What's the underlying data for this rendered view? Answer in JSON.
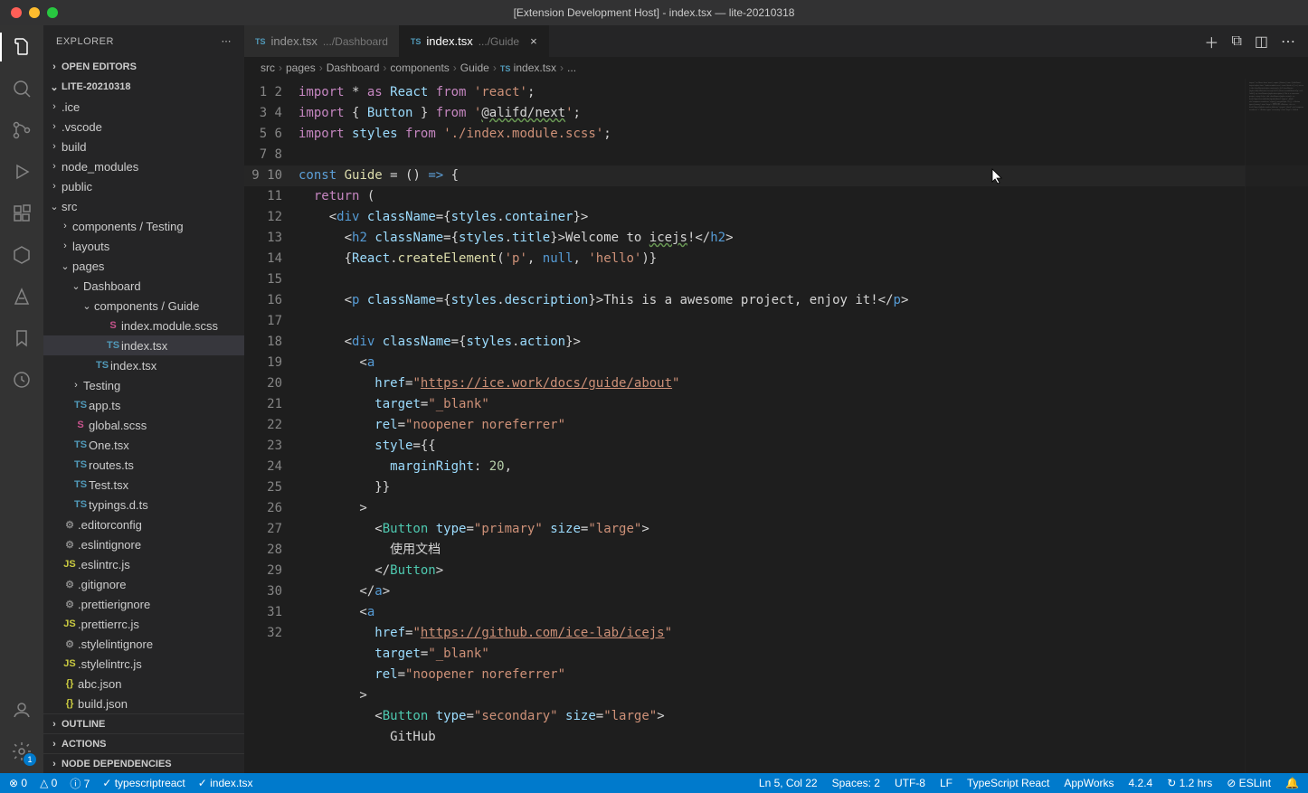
{
  "title": "[Extension Development Host] - index.tsx — lite-20210318",
  "explorer": {
    "title": "EXPLORER",
    "openEditors": "OPEN EDITORS",
    "project": "LITE-20210318",
    "outline": "OUTLINE",
    "actions": "ACTIONS",
    "nodeDeps": "NODE DEPENDENCIES"
  },
  "tree": [
    {
      "d": 1,
      "t": "folder",
      "open": false,
      "n": ".ice"
    },
    {
      "d": 1,
      "t": "folder",
      "open": false,
      "n": ".vscode"
    },
    {
      "d": 1,
      "t": "folder",
      "open": false,
      "n": "build"
    },
    {
      "d": 1,
      "t": "folder",
      "open": false,
      "n": "node_modules"
    },
    {
      "d": 1,
      "t": "folder",
      "open": false,
      "n": "public"
    },
    {
      "d": 1,
      "t": "folder",
      "open": true,
      "n": "src"
    },
    {
      "d": 2,
      "t": "folder",
      "open": false,
      "n": "components / Testing"
    },
    {
      "d": 2,
      "t": "folder",
      "open": false,
      "n": "layouts"
    },
    {
      "d": 2,
      "t": "folder",
      "open": true,
      "n": "pages"
    },
    {
      "d": 3,
      "t": "folder",
      "open": true,
      "n": "Dashboard"
    },
    {
      "d": 4,
      "t": "folder",
      "open": true,
      "n": "components / Guide"
    },
    {
      "d": 5,
      "t": "file",
      "i": "scss",
      "n": "index.module.scss"
    },
    {
      "d": 5,
      "t": "file",
      "i": "ts",
      "n": "index.tsx",
      "sel": true
    },
    {
      "d": 4,
      "t": "file",
      "i": "ts",
      "n": "index.tsx"
    },
    {
      "d": 3,
      "t": "folder",
      "open": false,
      "n": "Testing"
    },
    {
      "d": 2,
      "t": "file",
      "i": "ts",
      "n": "app.ts"
    },
    {
      "d": 2,
      "t": "file",
      "i": "scss",
      "n": "global.scss"
    },
    {
      "d": 2,
      "t": "file",
      "i": "ts",
      "n": "One.tsx"
    },
    {
      "d": 2,
      "t": "file",
      "i": "ts",
      "n": "routes.ts"
    },
    {
      "d": 2,
      "t": "file",
      "i": "ts",
      "n": "Test.tsx"
    },
    {
      "d": 2,
      "t": "file",
      "i": "ts",
      "n": "typings.d.ts"
    },
    {
      "d": 1,
      "t": "file",
      "i": "cfg",
      "n": ".editorconfig"
    },
    {
      "d": 1,
      "t": "file",
      "i": "cfg",
      "n": ".eslintignore"
    },
    {
      "d": 1,
      "t": "file",
      "i": "js",
      "n": ".eslintrc.js"
    },
    {
      "d": 1,
      "t": "file",
      "i": "cfg",
      "n": ".gitignore"
    },
    {
      "d": 1,
      "t": "file",
      "i": "cfg",
      "n": ".prettierignore"
    },
    {
      "d": 1,
      "t": "file",
      "i": "js",
      "n": ".prettierrc.js"
    },
    {
      "d": 1,
      "t": "file",
      "i": "cfg",
      "n": ".stylelintignore"
    },
    {
      "d": 1,
      "t": "file",
      "i": "js",
      "n": ".stylelintrc.js"
    },
    {
      "d": 1,
      "t": "file",
      "i": "json",
      "n": "abc.json"
    },
    {
      "d": 1,
      "t": "file",
      "i": "json",
      "n": "build.json"
    }
  ],
  "tabs": [
    {
      "lang": "TS",
      "name": "index.tsx",
      "hint": ".../Dashboard",
      "active": false
    },
    {
      "lang": "TS",
      "name": "index.tsx",
      "hint": ".../Guide",
      "active": true
    }
  ],
  "breadcrumb": [
    "src",
    "pages",
    "Dashboard",
    "components",
    "Guide",
    "index.tsx",
    "..."
  ],
  "bc_lang": "TS",
  "gutter_start": 1,
  "gutter_end": 32,
  "code_lines": [
    [
      [
        "kw",
        "import"
      ],
      [
        "op",
        " * "
      ],
      [
        "kw",
        "as"
      ],
      [
        "op",
        " "
      ],
      [
        "id",
        "React"
      ],
      [
        "op",
        " "
      ],
      [
        "kw",
        "from"
      ],
      [
        "op",
        " "
      ],
      [
        "st",
        "'react'"
      ],
      [
        "pu",
        ";"
      ]
    ],
    [
      [
        "kw",
        "import"
      ],
      [
        "op",
        " { "
      ],
      [
        "id",
        "Button"
      ],
      [
        "op",
        " } "
      ],
      [
        "kw",
        "from"
      ],
      [
        "op",
        " "
      ],
      [
        "st",
        "'"
      ],
      [
        "ul",
        "@alifd/next"
      ],
      [
        "st",
        "'"
      ],
      [
        "pu",
        ";"
      ]
    ],
    [
      [
        "kw",
        "import"
      ],
      [
        "op",
        " "
      ],
      [
        "id",
        "styles"
      ],
      [
        "op",
        " "
      ],
      [
        "kw",
        "from"
      ],
      [
        "op",
        " "
      ],
      [
        "st",
        "'./index.module.scss'"
      ],
      [
        "pu",
        ";"
      ]
    ],
    [],
    [
      [
        "kw2",
        "const"
      ],
      [
        "op",
        " "
      ],
      [
        "fn",
        "Guide"
      ],
      [
        "op",
        " = () "
      ],
      [
        "kw2",
        "=>"
      ],
      [
        "op",
        " {"
      ]
    ],
    [
      [
        "op",
        "  "
      ],
      [
        "kw",
        "return"
      ],
      [
        "op",
        " ("
      ]
    ],
    [
      [
        "op",
        "    <"
      ],
      [
        "tg",
        "div"
      ],
      [
        "op",
        " "
      ],
      [
        "at",
        "className"
      ],
      [
        "op",
        "={"
      ],
      [
        "id",
        "styles"
      ],
      [
        "op",
        "."
      ],
      [
        "id",
        "container"
      ],
      [
        "op",
        "}>"
      ]
    ],
    [
      [
        "op",
        "      <"
      ],
      [
        "tg",
        "h2"
      ],
      [
        "op",
        " "
      ],
      [
        "at",
        "className"
      ],
      [
        "op",
        "={"
      ],
      [
        "id",
        "styles"
      ],
      [
        "op",
        "."
      ],
      [
        "id",
        "title"
      ],
      [
        "op",
        "}>Welcome to "
      ],
      [
        "ul",
        "icejs"
      ],
      [
        "op",
        "!</"
      ],
      [
        "tg",
        "h2"
      ],
      [
        "op",
        ">"
      ]
    ],
    [
      [
        "op",
        "      {"
      ],
      [
        "id",
        "React"
      ],
      [
        "op",
        "."
      ],
      [
        "fn",
        "createElement"
      ],
      [
        "op",
        "("
      ],
      [
        "st",
        "'p'"
      ],
      [
        "op",
        ", "
      ],
      [
        "kw2",
        "null"
      ],
      [
        "op",
        ", "
      ],
      [
        "st",
        "'hello'"
      ],
      [
        "op",
        ")}"
      ]
    ],
    [],
    [
      [
        "op",
        "      <"
      ],
      [
        "tg",
        "p"
      ],
      [
        "op",
        " "
      ],
      [
        "at",
        "className"
      ],
      [
        "op",
        "={"
      ],
      [
        "id",
        "styles"
      ],
      [
        "op",
        "."
      ],
      [
        "id",
        "description"
      ],
      [
        "op",
        "}>This is a awesome project, enjoy it!</"
      ],
      [
        "tg",
        "p"
      ],
      [
        "op",
        ">"
      ]
    ],
    [],
    [
      [
        "op",
        "      <"
      ],
      [
        "tg",
        "div"
      ],
      [
        "op",
        " "
      ],
      [
        "at",
        "className"
      ],
      [
        "op",
        "={"
      ],
      [
        "id",
        "styles"
      ],
      [
        "op",
        "."
      ],
      [
        "id",
        "action"
      ],
      [
        "op",
        "}>"
      ]
    ],
    [
      [
        "op",
        "        <"
      ],
      [
        "tg",
        "a"
      ]
    ],
    [
      [
        "op",
        "          "
      ],
      [
        "at",
        "href"
      ],
      [
        "op",
        "="
      ],
      [
        "st",
        "\""
      ],
      [
        "lk",
        "https://ice.work/docs/guide/about"
      ],
      [
        "st",
        "\""
      ]
    ],
    [
      [
        "op",
        "          "
      ],
      [
        "at",
        "target"
      ],
      [
        "op",
        "="
      ],
      [
        "st",
        "\"_blank\""
      ]
    ],
    [
      [
        "op",
        "          "
      ],
      [
        "at",
        "rel"
      ],
      [
        "op",
        "="
      ],
      [
        "st",
        "\"noopener noreferrer\""
      ]
    ],
    [
      [
        "op",
        "          "
      ],
      [
        "at",
        "style"
      ],
      [
        "op",
        "={{"
      ]
    ],
    [
      [
        "op",
        "            "
      ],
      [
        "id",
        "marginRight"
      ],
      [
        "op",
        ": "
      ],
      [
        "nu",
        "20"
      ],
      [
        "op",
        ","
      ]
    ],
    [
      [
        "op",
        "          }}"
      ]
    ],
    [
      [
        "op",
        "        >"
      ]
    ],
    [
      [
        "op",
        "          <"
      ],
      [
        "ty",
        "Button"
      ],
      [
        "op",
        " "
      ],
      [
        "at",
        "type"
      ],
      [
        "op",
        "="
      ],
      [
        "st",
        "\"primary\""
      ],
      [
        "op",
        " "
      ],
      [
        "at",
        "size"
      ],
      [
        "op",
        "="
      ],
      [
        "st",
        "\"large\""
      ],
      [
        "op",
        ">"
      ]
    ],
    [
      [
        "op",
        "            使用文档"
      ]
    ],
    [
      [
        "op",
        "          </"
      ],
      [
        "ty",
        "Button"
      ],
      [
        "op",
        ">"
      ]
    ],
    [
      [
        "op",
        "        </"
      ],
      [
        "tg",
        "a"
      ],
      [
        "op",
        ">"
      ]
    ],
    [
      [
        "op",
        "        <"
      ],
      [
        "tg",
        "a"
      ]
    ],
    [
      [
        "op",
        "          "
      ],
      [
        "at",
        "href"
      ],
      [
        "op",
        "="
      ],
      [
        "st",
        "\""
      ],
      [
        "lk",
        "https://github.com/ice-lab/icejs"
      ],
      [
        "st",
        "\""
      ]
    ],
    [
      [
        "op",
        "          "
      ],
      [
        "at",
        "target"
      ],
      [
        "op",
        "="
      ],
      [
        "st",
        "\"_blank\""
      ]
    ],
    [
      [
        "op",
        "          "
      ],
      [
        "at",
        "rel"
      ],
      [
        "op",
        "="
      ],
      [
        "st",
        "\"noopener noreferrer\""
      ]
    ],
    [
      [
        "op",
        "        >"
      ]
    ],
    [
      [
        "op",
        "          <"
      ],
      [
        "ty",
        "Button"
      ],
      [
        "op",
        " "
      ],
      [
        "at",
        "type"
      ],
      [
        "op",
        "="
      ],
      [
        "st",
        "\"secondary\""
      ],
      [
        "op",
        " "
      ],
      [
        "at",
        "size"
      ],
      [
        "op",
        "="
      ],
      [
        "st",
        "\"large\""
      ],
      [
        "op",
        ">"
      ]
    ],
    [
      [
        "op",
        "            GitHub"
      ]
    ]
  ],
  "status": {
    "errors": "⊗ 0",
    "warnings": "△ 0",
    "info": "ⓘ 7",
    "lang": "✓ typescriptreact",
    "file": "✓ index.tsx",
    "pos": "Ln 5, Col 22",
    "spaces": "Spaces: 2",
    "enc": "UTF-8",
    "eol": "LF",
    "mode": "TypeScript React",
    "app": "AppWorks",
    "ver": "4.2.4",
    "time": "↻ 1.2 hrs",
    "eslint": "⊘ ESLint",
    "bell": "🔔"
  }
}
